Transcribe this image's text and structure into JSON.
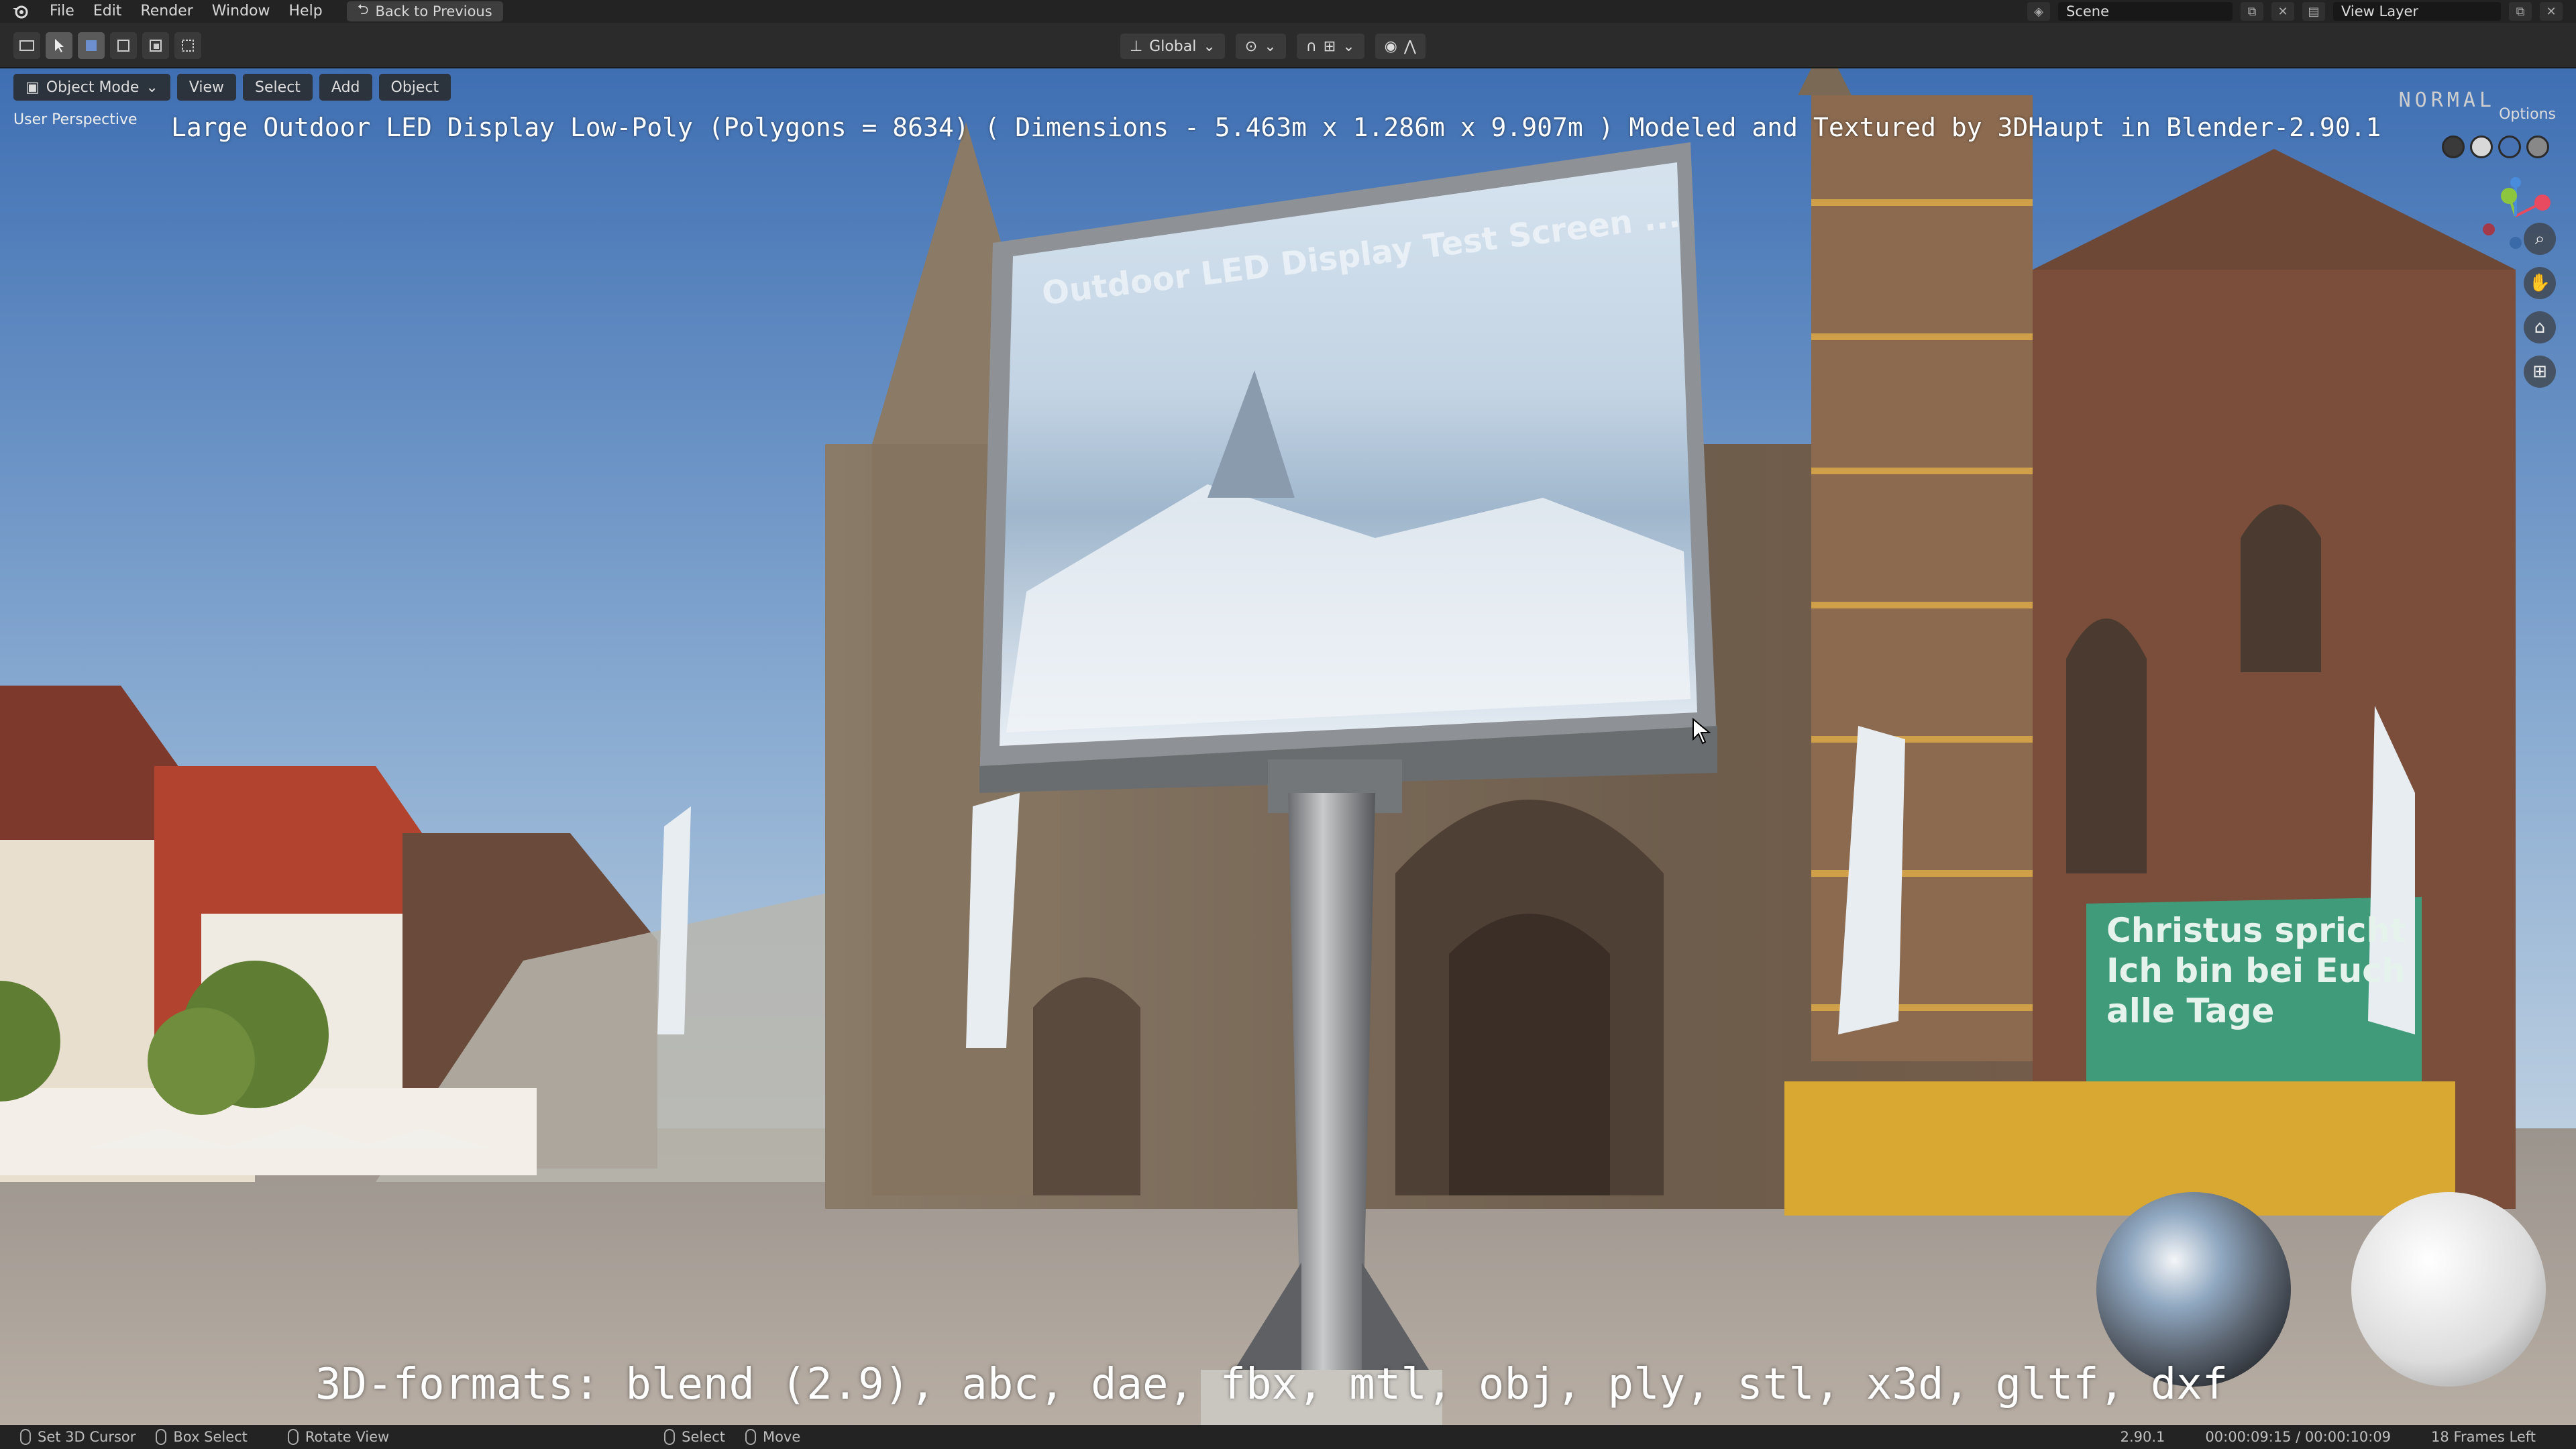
{
  "menu": {
    "items": [
      "File",
      "Edit",
      "Render",
      "Window",
      "Help"
    ],
    "back_button": "Back to Previous"
  },
  "top_right": {
    "scene": "Scene",
    "view_layer": "View Layer"
  },
  "tool_header": {
    "transform_orientation": "Global"
  },
  "viewport_header": {
    "mode": "Object Mode",
    "view": "View",
    "select": "Select",
    "add": "Add",
    "object": "Object",
    "options": "Options"
  },
  "viewport": {
    "perspective": "User Perspective",
    "watermark": "NORMAL",
    "model_info": "Large Outdoor LED Display Low-Poly (Polygons = 8634) ( Dimensions -  5.463m x 1.286m x 9.907m ) Modeled and Textured by 3DHaupt in Blender-2.90.1",
    "formats": "3D-formats: blend (2.9), abc, dae, fbx, mtl, obj, ply, stl, x3d, gltf, dxf",
    "screen_text": "Outdoor LED Display Test Screen ...",
    "banner_text_1": "Christus spricht",
    "banner_text_2": "Ich bin bei Euch",
    "banner_text_3": "alle Tage"
  },
  "status": {
    "set_cursor": "Set 3D Cursor",
    "box_select": "Box Select",
    "rotate_view": "Rotate View",
    "select": "Select",
    "move": "Move",
    "version": "2.90.1",
    "time": "00:00:09:15 / 00:00:10:09",
    "frames_left": "18 Frames Left"
  },
  "colors": {
    "sky_top": "#4a78b8",
    "sky_bottom": "#b9cfe4",
    "ground": "#a39a90",
    "cathedral": "#8b7560",
    "accent": "#4772b3"
  }
}
